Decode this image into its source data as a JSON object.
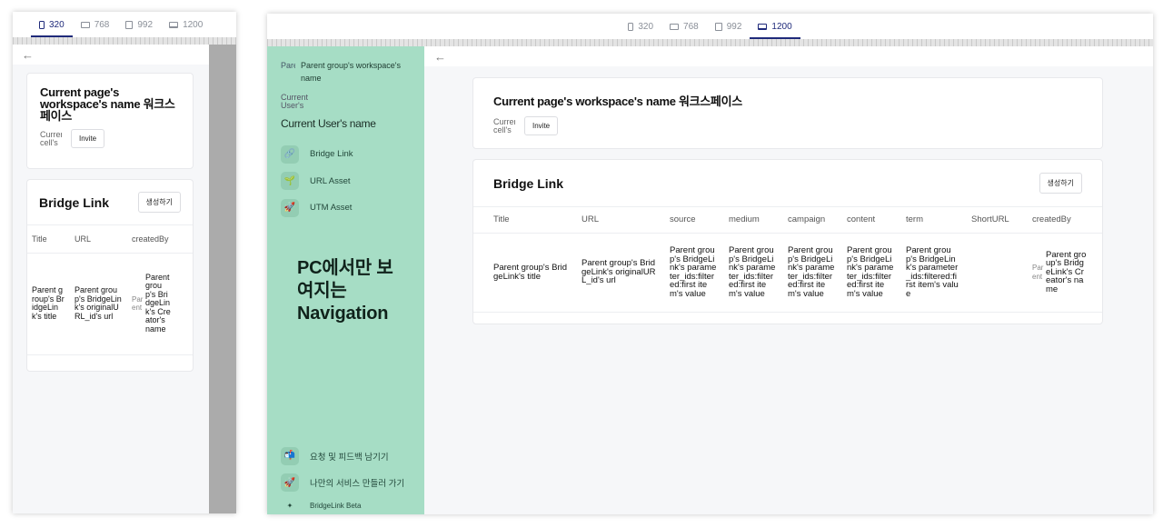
{
  "devices": [
    {
      "label": "320",
      "kind": "phone"
    },
    {
      "label": "768",
      "kind": "tablet-landscape"
    },
    {
      "label": "992",
      "kind": "tablet-portrait"
    },
    {
      "label": "1200",
      "kind": "monitor"
    }
  ],
  "workspace": {
    "title": "Current page's workspace's name 워크스페이스",
    "avatar_text": "Current cell's",
    "invite_label": "Invite"
  },
  "bridge_link": {
    "title": "Bridge Link",
    "create_label": "생성하기",
    "mobile_columns": [
      "Title",
      "URL",
      "createdBy"
    ],
    "desktop_columns": [
      "Title",
      "URL",
      "source",
      "medium",
      "campaign",
      "content",
      "term",
      "ShortURL",
      "createdBy"
    ],
    "row": {
      "title": "Parent group's BridgeLink's title",
      "url_mobile": "Parent group's BridgeLink's originalURL_id's url",
      "url_desktop": "Parent group's BridgeLink's originalURL_id's url",
      "param": "Parent group's BridgeLink's parameter_ids:filtered:first item's value",
      "shorturl": "",
      "creator_avatar": "Parent",
      "creator": "Parent group's BridgeLink's Creator's name"
    }
  },
  "nav": {
    "parent_avatar": "Parent",
    "parent_workspace": "Parent group's workspace's name",
    "user_avatar": "Current User's",
    "user_name": "Current User's name",
    "items": [
      {
        "label": "Bridge Link",
        "icon": "link-icon"
      },
      {
        "label": "URL Asset",
        "icon": "sprout-icon"
      },
      {
        "label": "UTM Asset",
        "icon": "rocket-icon"
      }
    ],
    "bottom_items": [
      {
        "label": "요청 및 피드백 남기기",
        "icon": "mailbox-icon"
      },
      {
        "label": "나만의 서비스 만들러 가기",
        "icon": "rocket-icon"
      }
    ],
    "beta_label": "BridgeLink Beta",
    "overlay_note": "PC에서만 보여지는 Navigation"
  },
  "colors": {
    "nav_bg": "#a6ddc5",
    "accent": "#1f2a7a",
    "page_bg": "#f6f7f9"
  }
}
